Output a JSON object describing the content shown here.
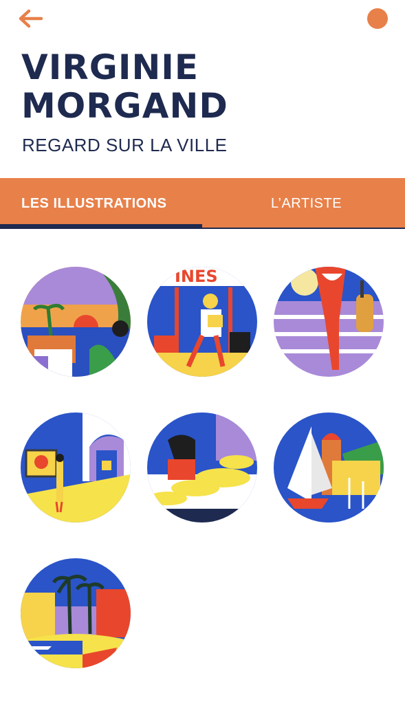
{
  "header": {
    "back_icon": "arrow-left-icon",
    "menu_icon": "orange-dot-icon",
    "title_line1": "VIRGINIE",
    "title_line2": "MORGAND",
    "subtitle": "REGARD SUR LA VILLE"
  },
  "tabs": [
    {
      "label": "LES ILLUSTRATIONS",
      "active": true
    },
    {
      "label": "L’ARTISTE",
      "active": false
    }
  ],
  "colors": {
    "accent": "#e8804a",
    "navy": "#1e2a4f"
  }
}
